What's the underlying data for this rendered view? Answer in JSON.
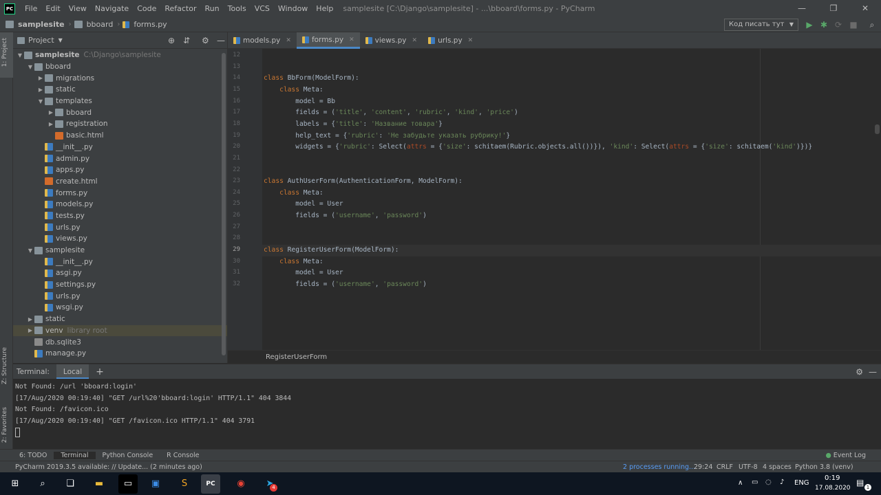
{
  "window": {
    "title": "samplesite [C:\\Django\\samplesite] - ...\\bboard\\forms.py - PyCharm",
    "logo": "PC"
  },
  "menu": [
    "File",
    "Edit",
    "View",
    "Navigate",
    "Code",
    "Refactor",
    "Run",
    "Tools",
    "VCS",
    "Window",
    "Help"
  ],
  "nav": {
    "crumbs": [
      "samplesite",
      "bboard",
      "forms.py"
    ],
    "run_config": "Код писать тут"
  },
  "side": {
    "project": "1: Project",
    "structure": "Z: Structure",
    "favorites": "2: Favorites"
  },
  "project_panel": {
    "title": "Project",
    "tree": [
      {
        "label": "samplesite",
        "hint": "C:\\Django\\samplesite",
        "depth": 0,
        "type": "folder",
        "open": true,
        "bold": true
      },
      {
        "label": "bboard",
        "depth": 1,
        "type": "folder",
        "open": true
      },
      {
        "label": "migrations",
        "depth": 2,
        "type": "folder",
        "open": false
      },
      {
        "label": "static",
        "depth": 2,
        "type": "folder",
        "open": false
      },
      {
        "label": "templates",
        "depth": 2,
        "type": "folder",
        "open": true
      },
      {
        "label": "bboard",
        "depth": 3,
        "type": "folder",
        "open": false
      },
      {
        "label": "registration",
        "depth": 3,
        "type": "folder",
        "open": false
      },
      {
        "label": "basic.html",
        "depth": 3,
        "type": "html"
      },
      {
        "label": "__init__.py",
        "depth": 2,
        "type": "py"
      },
      {
        "label": "admin.py",
        "depth": 2,
        "type": "py"
      },
      {
        "label": "apps.py",
        "depth": 2,
        "type": "py"
      },
      {
        "label": "create.html",
        "depth": 2,
        "type": "html"
      },
      {
        "label": "forms.py",
        "depth": 2,
        "type": "py"
      },
      {
        "label": "models.py",
        "depth": 2,
        "type": "py"
      },
      {
        "label": "tests.py",
        "depth": 2,
        "type": "py"
      },
      {
        "label": "urls.py",
        "depth": 2,
        "type": "py"
      },
      {
        "label": "views.py",
        "depth": 2,
        "type": "py"
      },
      {
        "label": "samplesite",
        "depth": 1,
        "type": "folder",
        "open": true
      },
      {
        "label": "__init__.py",
        "depth": 2,
        "type": "py"
      },
      {
        "label": "asgi.py",
        "depth": 2,
        "type": "py"
      },
      {
        "label": "settings.py",
        "depth": 2,
        "type": "py"
      },
      {
        "label": "urls.py",
        "depth": 2,
        "type": "py"
      },
      {
        "label": "wsgi.py",
        "depth": 2,
        "type": "py"
      },
      {
        "label": "static",
        "depth": 1,
        "type": "folder",
        "open": false
      },
      {
        "label": "venv",
        "hint": "library root",
        "depth": 1,
        "type": "folder",
        "open": false,
        "selected": true
      },
      {
        "label": "db.sqlite3",
        "depth": 1,
        "type": "db"
      },
      {
        "label": "manage.py",
        "depth": 1,
        "type": "py"
      }
    ]
  },
  "tabs": [
    {
      "label": "models.py"
    },
    {
      "label": "forms.py",
      "active": true
    },
    {
      "label": "views.py"
    },
    {
      "label": "urls.py"
    }
  ],
  "editor": {
    "current_line": "29",
    "lines": [
      {
        "n": "12",
        "tokens": []
      },
      {
        "n": "13",
        "tokens": []
      },
      {
        "n": "14",
        "tokens": [
          [
            "kw",
            "class "
          ],
          [
            "cls",
            "BbForm("
          ],
          [
            "cls",
            "ModelForm"
          ],
          [
            "cls",
            "):"
          ]
        ]
      },
      {
        "n": "15",
        "tokens": [
          [
            "cls",
            "    "
          ],
          [
            "kw",
            "class "
          ],
          [
            "cls",
            "Meta:"
          ]
        ]
      },
      {
        "n": "16",
        "tokens": [
          [
            "cls",
            "        model = Bb"
          ]
        ]
      },
      {
        "n": "17",
        "tokens": [
          [
            "cls",
            "        fields = ("
          ],
          [
            "str",
            "'title'"
          ],
          [
            "cls",
            ", "
          ],
          [
            "str",
            "'content'"
          ],
          [
            "cls",
            ", "
          ],
          [
            "str",
            "'rubric'"
          ],
          [
            "cls",
            ", "
          ],
          [
            "str",
            "'kind'"
          ],
          [
            "cls",
            ", "
          ],
          [
            "str",
            "'price'"
          ],
          [
            "cls",
            ")"
          ]
        ]
      },
      {
        "n": "18",
        "tokens": [
          [
            "cls",
            "        labels = {"
          ],
          [
            "str",
            "'title'"
          ],
          [
            "cls",
            ": "
          ],
          [
            "str",
            "'Название товара'"
          ],
          [
            "cls",
            "}"
          ]
        ]
      },
      {
        "n": "19",
        "tokens": [
          [
            "cls",
            "        help_text = {"
          ],
          [
            "str",
            "'rubric'"
          ],
          [
            "cls",
            ": "
          ],
          [
            "str",
            "'Не забудьте указать рубрику!'"
          ],
          [
            "cls",
            "}"
          ]
        ]
      },
      {
        "n": "20",
        "tokens": [
          [
            "cls",
            "        widgets = {"
          ],
          [
            "str",
            "'rubric'"
          ],
          [
            "cls",
            ": Select("
          ],
          [
            "par",
            "attrs"
          ],
          [
            "cls",
            " = {"
          ],
          [
            "str",
            "'size'"
          ],
          [
            "cls",
            ": schitaem(Rubric.objects.all())}), "
          ],
          [
            "str",
            "'kind'"
          ],
          [
            "cls",
            ": Select("
          ],
          [
            "par",
            "attrs"
          ],
          [
            "cls",
            " = {"
          ],
          [
            "str",
            "'size'"
          ],
          [
            "cls",
            ": schitaem("
          ],
          [
            "str",
            "'kind'"
          ],
          [
            "cls",
            ")})}"
          ]
        ]
      },
      {
        "n": "21",
        "tokens": []
      },
      {
        "n": "22",
        "tokens": []
      },
      {
        "n": "23",
        "tokens": [
          [
            "kw",
            "class "
          ],
          [
            "cls",
            "AuthUserForm(AuthenticationForm, ModelForm):"
          ]
        ]
      },
      {
        "n": "24",
        "tokens": [
          [
            "cls",
            "    "
          ],
          [
            "kw",
            "class "
          ],
          [
            "cls",
            "Meta:"
          ]
        ]
      },
      {
        "n": "25",
        "tokens": [
          [
            "cls",
            "        model = User"
          ]
        ]
      },
      {
        "n": "26",
        "tokens": [
          [
            "cls",
            "        fields = ("
          ],
          [
            "str",
            "'username'"
          ],
          [
            "cls",
            ", "
          ],
          [
            "str",
            "'password'"
          ],
          [
            "cls",
            ")"
          ]
        ]
      },
      {
        "n": "27",
        "tokens": []
      },
      {
        "n": "28",
        "tokens": []
      },
      {
        "n": "29",
        "tokens": [
          [
            "kw",
            "class "
          ],
          [
            "cls",
            "RegisterUserForm(ModelForm):"
          ]
        ]
      },
      {
        "n": "30",
        "tokens": [
          [
            "cls",
            "    "
          ],
          [
            "kw",
            "class "
          ],
          [
            "cls",
            "Meta:"
          ]
        ]
      },
      {
        "n": "31",
        "tokens": [
          [
            "cls",
            "        model = User"
          ]
        ]
      },
      {
        "n": "32",
        "tokens": [
          [
            "cls",
            "        fields = ("
          ],
          [
            "str",
            "'username'"
          ],
          [
            "cls",
            ", "
          ],
          [
            "str",
            "'password'"
          ],
          [
            "cls",
            ")"
          ]
        ]
      }
    ]
  },
  "editor_breadcrumb": "RegisterUserForm",
  "terminal": {
    "label": "Terminal:",
    "tab": "Local",
    "lines": [
      "Not Found: /url 'bboard:login'",
      "[17/Aug/2020 00:19:40] \"GET /url%20'bboard:login' HTTP/1.1\" 404 3844",
      "Not Found: /favicon.ico",
      "[17/Aug/2020 00:19:40] \"GET /favicon.ico HTTP/1.1\" 404 3791"
    ]
  },
  "toolwindows": [
    "6: TODO",
    "Terminal",
    "Python Console",
    "R Console"
  ],
  "event_log": "Event Log",
  "status": {
    "message": "PyCharm 2019.3.5 available: // Update... (2 minutes ago)",
    "processes": "2 processes running...",
    "position": "29:24",
    "line_sep": "CRLF",
    "encoding": "UTF-8",
    "indent": "4 spaces",
    "interpreter": "Python 3.8 (venv)"
  },
  "taskbar": {
    "lang": "ENG",
    "time": "0:19",
    "date": "17.08.2020",
    "badge": "4",
    "notif": "1"
  }
}
